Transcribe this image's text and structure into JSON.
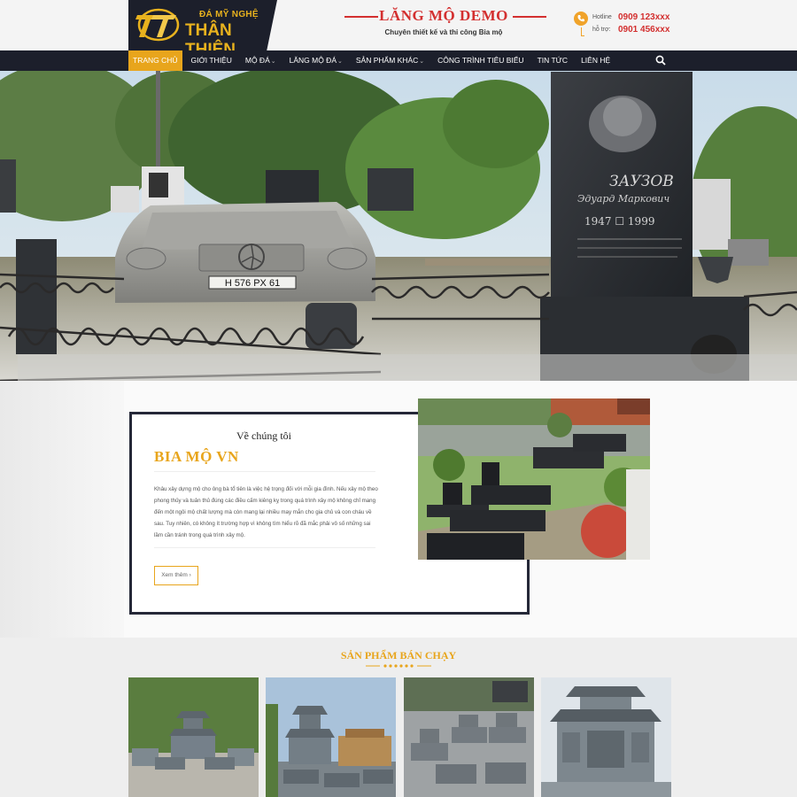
{
  "header": {
    "logo_small": "ĐÁ MỸ NGHỆ",
    "logo_big": "THÂN THIỆN",
    "brand_title": "LĂNG MỘ DEMO",
    "brand_subtitle": "Chuyên thiết kế và thi công Bia mộ",
    "hotline_label": "Hotline",
    "hotline_number": "0909 123xxx",
    "support_label": "hỗ trợ:",
    "support_number": "0901 456xxx",
    "accent_color": "#e8a51c",
    "red_color": "#d32f2f"
  },
  "nav": {
    "items": [
      {
        "label": "TRANG CHỦ",
        "active": true
      },
      {
        "label": "GIỚI THIỆU"
      },
      {
        "label": "MỘ ĐÁ",
        "caret": "⌄"
      },
      {
        "label": "LĂNG MỘ ĐÁ",
        "caret": "⌄"
      },
      {
        "label": "SẢN PHẨM KHÁC",
        "caret": "⌄"
      },
      {
        "label": "CÔNG TRÌNH TIÊU BIỂU"
      },
      {
        "label": "TIN TỨC"
      },
      {
        "label": "LIÊN HỆ"
      }
    ],
    "search_icon": "search-icon"
  },
  "hero": {
    "plate_text": "H 576 PX 61",
    "headstone_name": "ЗАУЗОВ",
    "headstone_given": "Эдуард Маркович",
    "headstone_years": "1947 ☐ 1999"
  },
  "about": {
    "subtitle": "Về chúng tôi",
    "title": "BIA MỘ VN",
    "paragraph": "Khâu xây dựng mộ cho ông bà tổ tiên là việc hệ trọng đối với mỗi gia đình. Nếu xây mộ theo phong thủy và tuân thủ đúng các điều cấm kiêng kỵ trong quá trình xây mộ không chỉ mang đến một ngôi mộ chất lượng mà còn mang lại nhiều may mắn cho gia chủ và con cháu về sau. Tuy nhiên, có không ít trường hợp vì không tìm hiểu rõ đã mắc phải vô số những sai lầm cần tránh trong quá trình xây mộ.",
    "button_label": "Xem thêm",
    "button_arrow": "›"
  },
  "products": {
    "title": "SẢN PHẨM BÁN CHẠY",
    "cards": [
      {
        "name": "product-1"
      },
      {
        "name": "product-2"
      },
      {
        "name": "product-3"
      },
      {
        "name": "product-4"
      }
    ]
  }
}
